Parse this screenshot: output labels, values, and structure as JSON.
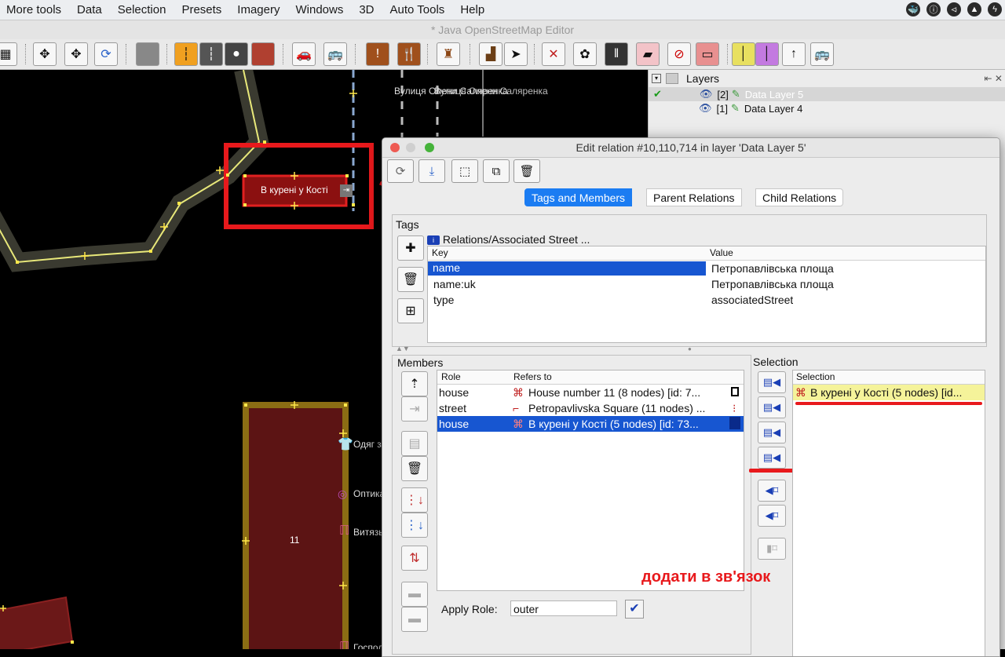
{
  "menu": {
    "items": [
      "More tools",
      "Data",
      "Selection",
      "Presets",
      "Imagery",
      "Windows",
      "3D",
      "Auto Tools",
      "Help"
    ]
  },
  "window": {
    "title": "* Java OpenStreetMap Editor"
  },
  "toolbar": {
    "buttons": [
      "wireframe-icon",
      "snap-icon",
      "refresh-icon",
      "imagery-icon",
      "street-icon",
      "road-icon",
      "traffic-light-icon",
      "building-icon",
      "car-icon",
      "bus-icon",
      "warning-icon",
      "restaurant-icon",
      "castle-icon",
      "factory-icon",
      "select-icon",
      "cross-icon",
      "relation-icon",
      "railway-icon",
      "ticket-icon",
      "no-turn-icon",
      "sign-icon",
      "yellow-line-icon",
      "purple-line-icon",
      "arrow-up-icon",
      "bus-stop-icon"
    ]
  },
  "map": {
    "street_label": "Вулиця Олени Саляренка",
    "street_label_overlap": "Вулиця Олени Саляренка",
    "selected_building_label": "В курені у Кості",
    "building_number": "11",
    "pois": [
      "Одяг з",
      "Оптика",
      "Витязь",
      "Господ"
    ],
    "annotation_text": "додати в зв'язок",
    "colors": {
      "building": "#5c1414",
      "highlight": "#e01010",
      "road": "#3a3a30",
      "road_line": "#e8e87a",
      "annotation": "#e8191c"
    }
  },
  "layers": {
    "title": "Layers",
    "items": [
      {
        "index": "[2]",
        "name": "Data Layer 5",
        "active": true
      },
      {
        "index": "[1]",
        "name": "Data Layer 4",
        "active": false
      }
    ]
  },
  "dialog": {
    "title": "Edit relation #10,110,714 in layer 'Data Layer 5'",
    "tabs": [
      "Tags and Members",
      "Parent Relations",
      "Child Relations"
    ],
    "tags": {
      "title": "Tags",
      "preset": "Relations/Associated Street ...",
      "columns": [
        "Key",
        "Value"
      ],
      "rows": [
        {
          "key": "name",
          "value": "Петропавлівська площа"
        },
        {
          "key": "name:uk",
          "value": "Петропавлівська площа"
        },
        {
          "key": "type",
          "value": "associatedStreet"
        }
      ]
    },
    "members": {
      "title": "Members",
      "columns": [
        "Role",
        "Refers to"
      ],
      "rows": [
        {
          "role": "house",
          "ref": "House number 11 (8 nodes) [id: 7..."
        },
        {
          "role": "street",
          "ref": "Petropavlivska Square (11 nodes) ..."
        },
        {
          "role": "house",
          "ref": "В курені у Кості (5 nodes) [id: 73..."
        }
      ]
    },
    "selection": {
      "title": "Selection",
      "column": "Selection",
      "rows": [
        "В курені у Кості (5 nodes) [id..."
      ]
    },
    "apply_role": {
      "label": "Apply Role:",
      "value": "outer"
    }
  }
}
